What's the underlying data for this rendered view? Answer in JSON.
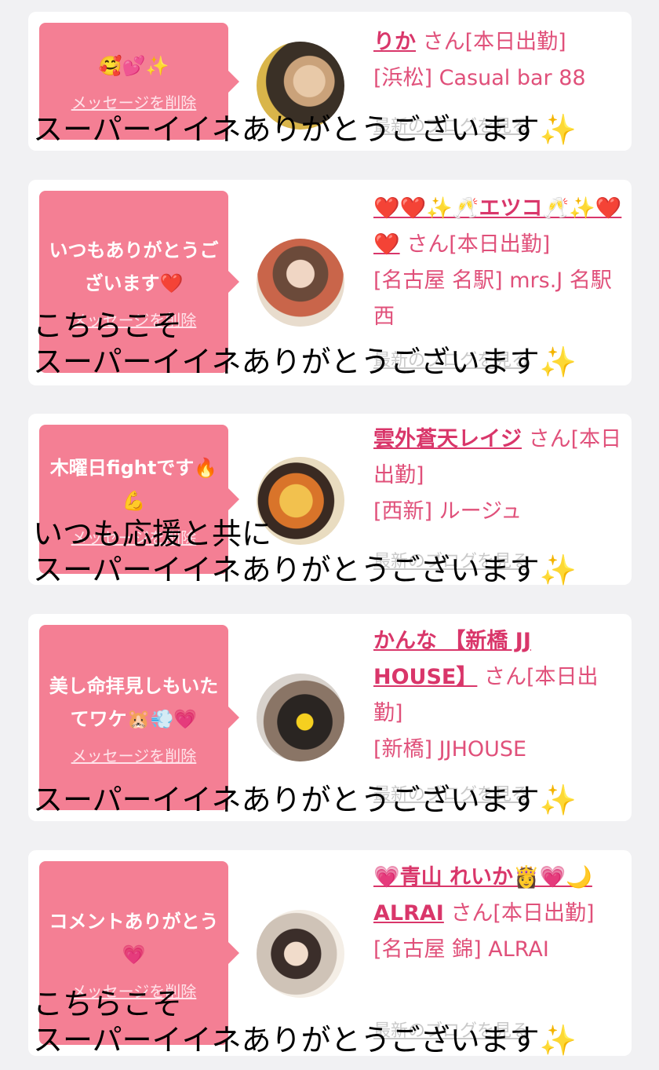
{
  "cards": [
    {
      "message": "🥰💕✨",
      "delete_label": "メッセージを削除",
      "name": "りか",
      "san": "さん[本日出勤]",
      "location": "[浜松] Casual bar 88",
      "blog_label": "最新のブログを見る",
      "caption_lines": [
        "スーパーイイネありがとうございます✨"
      ]
    },
    {
      "message": "いつもありがとうございます❤️",
      "delete_label": "メッセージを削除",
      "name": "❤️❤️✨🥂エツコ🥂✨❤️❤️",
      "san": "さん[本日出勤]",
      "location": "[名古屋 名駅] mrs.J 名駅西",
      "blog_label": "最新のブログを見る",
      "caption_lines": [
        "こちらこそ",
        "スーパーイイネありがとうございます✨"
      ]
    },
    {
      "message": "木曜日fightです🔥💪",
      "delete_label": "メッセージを削除",
      "name": "雲外蒼天レイジ",
      "san": "さん[本日出勤]",
      "location": "[西新] ルージュ",
      "blog_label": "最新のブログを見る",
      "caption_lines": [
        "いつも応援と共に",
        "スーパーイイネありがとうございます✨"
      ]
    },
    {
      "message": "美し命拝見しもいたてワケ🐹💨💗",
      "delete_label": "メッセージを削除",
      "name": "かんな 【新橋 JJ HOUSE】",
      "san": "さん[本日出勤]",
      "location": "[新橋] JJHOUSE",
      "blog_label": "最新のブログを見る",
      "caption_lines": [
        "スーパーイイネありがとうございます✨"
      ]
    },
    {
      "message": "コメントありがとう💗",
      "delete_label": "メッセージを削除",
      "name": "💗青山 れいか👸💗🌙ALRAI",
      "san": "さん[本日出勤]",
      "location": "[名古屋 錦] ALRAI",
      "blog_label": "最新のブログを見る",
      "caption_lines": [
        "こちらこそ",
        "スーパーイイネありがとうございます✨"
      ]
    }
  ]
}
